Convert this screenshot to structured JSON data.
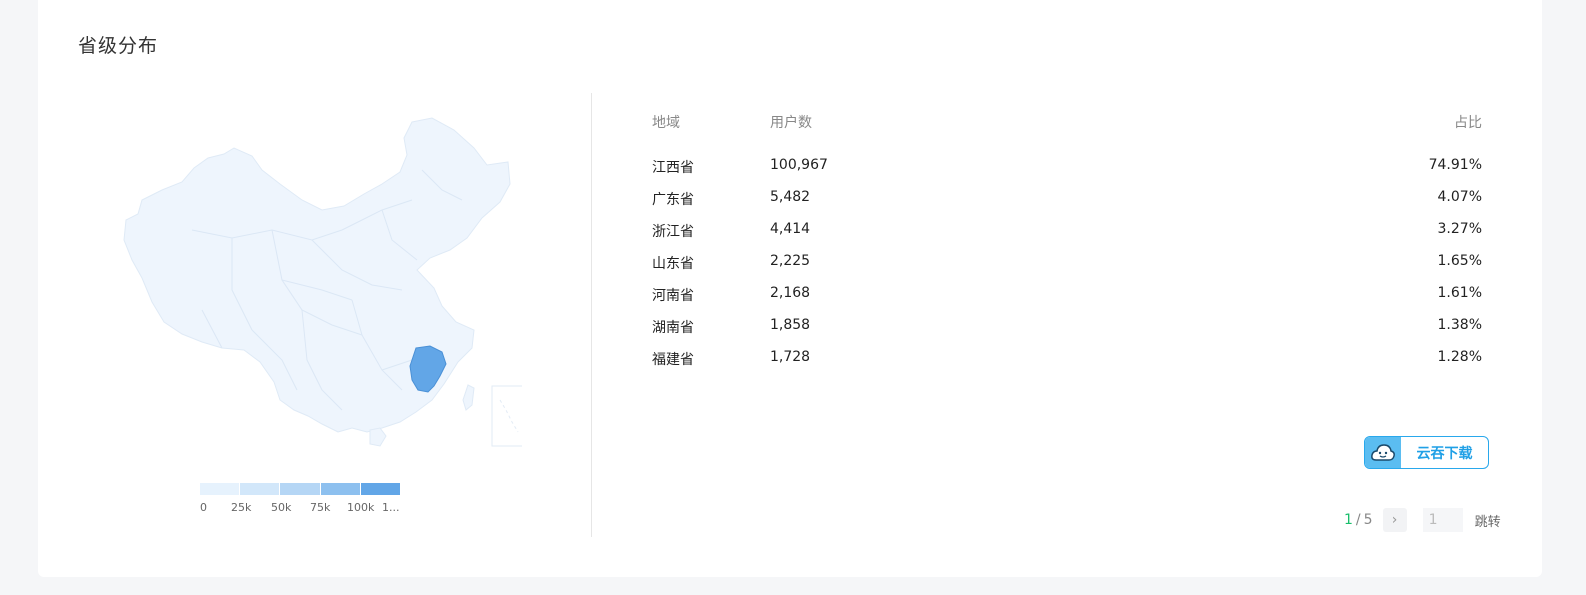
{
  "section": {
    "title": "省级分布"
  },
  "legend": {
    "labels": [
      "0",
      "25k",
      "50k",
      "75k",
      "100k",
      "1..."
    ],
    "colors": [
      "#e6f2fd",
      "#d2e7fa",
      "#b5d6f5",
      "#8dc0ef",
      "#62a6e7"
    ]
  },
  "map": {
    "base_fill": "#eef5fd",
    "highlight_fill": "#62a6e7",
    "highlight_region": "江西省"
  },
  "table": {
    "headers": {
      "region": "地域",
      "users": "用户数",
      "ratio": "占比"
    },
    "rows": [
      {
        "region": "江西省",
        "users": "100,967",
        "ratio": "74.91%"
      },
      {
        "region": "广东省",
        "users": "5,482",
        "ratio": "4.07%"
      },
      {
        "region": "浙江省",
        "users": "4,414",
        "ratio": "3.27%"
      },
      {
        "region": "山东省",
        "users": "2,225",
        "ratio": "1.65%"
      },
      {
        "region": "河南省",
        "users": "2,168",
        "ratio": "1.61%"
      },
      {
        "region": "湖南省",
        "users": "1,858",
        "ratio": "1.38%"
      },
      {
        "region": "福建省",
        "users": "1,728",
        "ratio": "1.28%"
      }
    ]
  },
  "cloud_button": {
    "label": "云吞下载",
    "icon": "cloud-face-icon"
  },
  "pager": {
    "current": "1",
    "separator": "/",
    "total": "5",
    "input_value": "1",
    "jump_label": "跳转"
  },
  "colors": {
    "accent": "#29a8ec",
    "page_current": "#19be6b"
  }
}
